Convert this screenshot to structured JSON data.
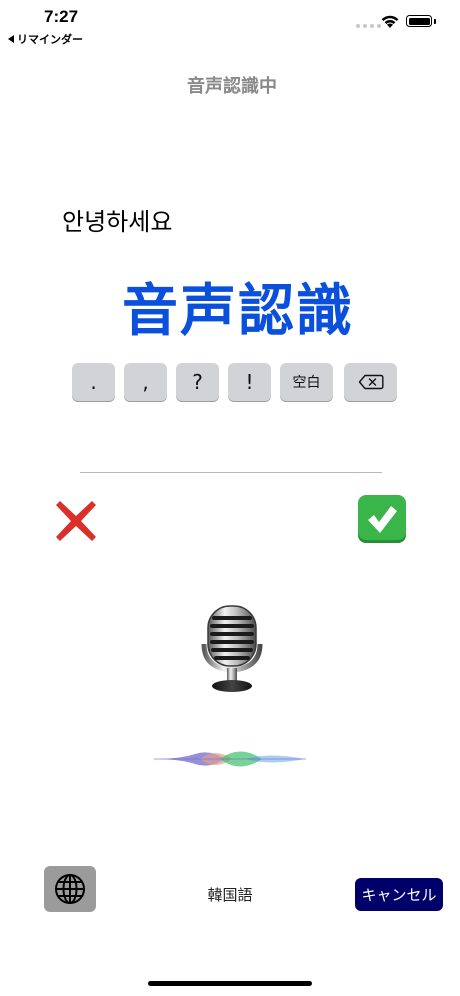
{
  "status_bar": {
    "time": "7:27",
    "back_app": "リマインダー",
    "icons": [
      "signal-dots-icon",
      "wifi-icon",
      "battery-icon"
    ]
  },
  "header": {
    "title": "音声認識中"
  },
  "recognized_text": "안녕하세요",
  "big_label": "音声認識",
  "keys": [
    ".",
    ",",
    "?",
    "!",
    "空白"
  ],
  "backspace_icon": "backspace-icon",
  "actions": {
    "reject_icon": "cross-mark-icon",
    "accept_icon": "check-mark-icon"
  },
  "mic_icon": "microphone-icon",
  "wave_icon": "voice-waveform-icon",
  "bottom": {
    "globe_icon": "globe-icon",
    "language": "韓国語",
    "cancel_label": "キャンセル"
  },
  "colors": {
    "big_label": "#0a50dc",
    "cancel_bg": "#00006b",
    "key_bg": "#d2d3d7",
    "accept_bg": "#3ab54a",
    "reject": "#d9312a"
  }
}
